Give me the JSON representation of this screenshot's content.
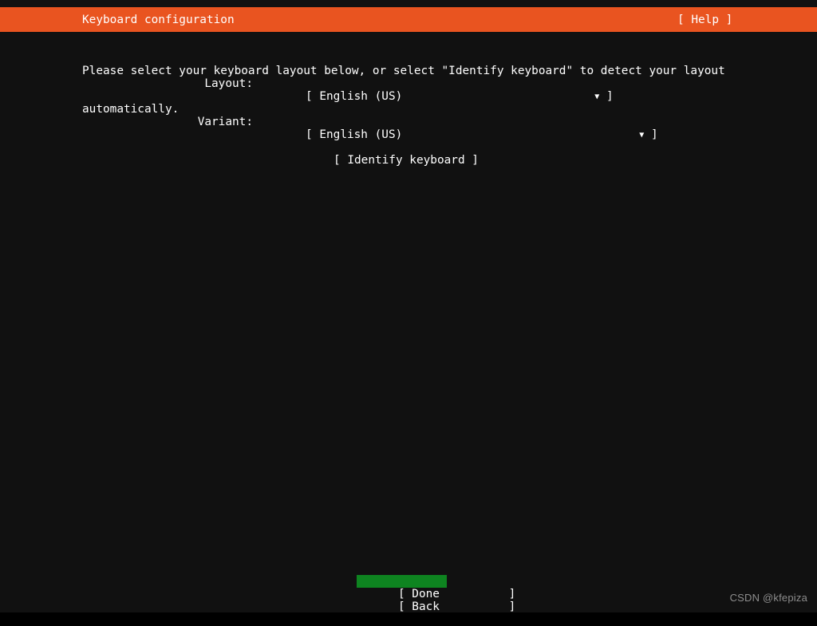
{
  "screen": {
    "background_color": "#111111",
    "foreground_color": "#ffffff"
  },
  "header": {
    "title": "Keyboard configuration",
    "help_label": "[ Help ]",
    "background_color": "#e95420"
  },
  "description": {
    "line1": "Please select your keyboard layout below, or select \"Identify keyboard\" to detect your layout",
    "line2": "automatically."
  },
  "form": {
    "layout": {
      "label": "Layout:",
      "open_bracket": "[",
      "value": "English (US)",
      "caret_icon": "▼",
      "close_bracket": "]"
    },
    "variant": {
      "label": "Variant:",
      "open_bracket": "[",
      "value": "English (US)",
      "caret_icon": "▼",
      "close_bracket": "]"
    },
    "identify_button": "[ Identify keyboard ]"
  },
  "footer": {
    "done_button": "[ Done          ]",
    "back_button": "[ Back          ]",
    "selected_button": "Done",
    "highlight_color": "#0e8420"
  },
  "watermark": {
    "text": "CSDN @kfepiza"
  }
}
